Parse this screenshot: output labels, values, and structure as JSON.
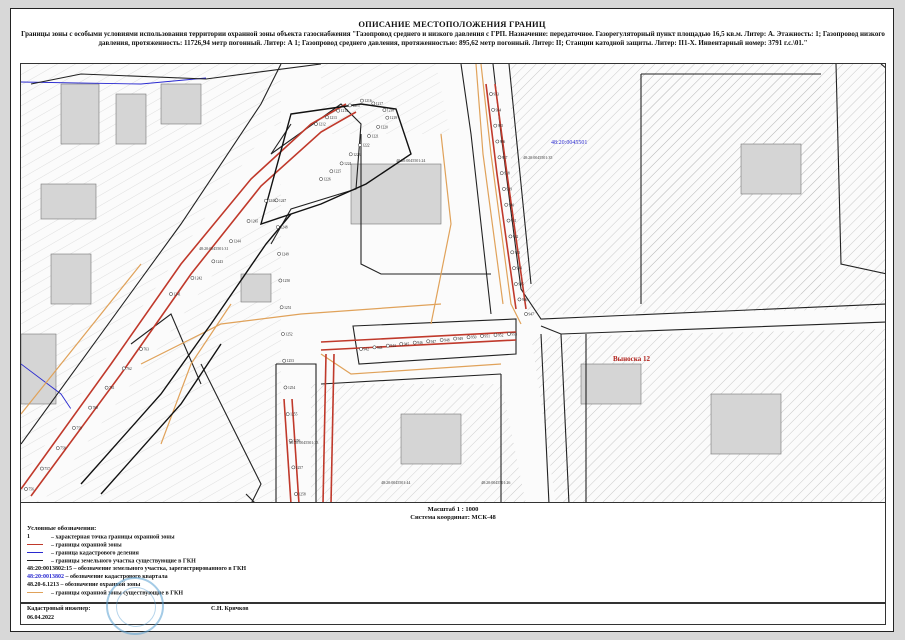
{
  "header": {
    "title": "ОПИСАНИЕ МЕСТОПОЛОЖЕНИЯ ГРАНИЦ",
    "subtitle": "Границы зоны с особыми условиями использования территории охранной зоны объекта газоснабжения \"Газопровод среднего и низкого давления с ГРП. Назначение: передаточное. Газорегуляторный пункт площадью 16,5 кв.м. Литер: А. Этажность: 1; Газопровод низкого давления, протяженность: 11726,94 метр погонный. Литер: А 1; Газопровод среднего давления, протяженностью: 895,62 метр погонный. Литер: II; Станции катодной защиты. Литер: II1-X. Инвентарный номер: 3791 г.с.\\01.\""
  },
  "map": {
    "labels": {
      "quarter_top": "48:20:0045501",
      "extract": "Выноска 12",
      "parcel_1": "48:20:0045501:24",
      "parcel_2": "48:20:0045501:35",
      "parcel_3": "48:20:0045501:31",
      "parcel_4": "48:20:0045501:33",
      "parcel_5": "48:20:0045501:44",
      "parcel_6": "48:20:0045501:26"
    },
    "points_upper": [
      "1212",
      "1213",
      "1214",
      "1215",
      "1216",
      "1217",
      "1218",
      "1219",
      "1220",
      "1221",
      "1222",
      "1223",
      "1224",
      "1225",
      "1226"
    ],
    "points_rail": [
      "933",
      "934",
      "935",
      "936",
      "937",
      "938",
      "939",
      "940",
      "941",
      "942",
      "943",
      "944",
      "945",
      "946",
      "947"
    ],
    "points_block": [
      "942",
      "943",
      "944",
      "945",
      "946",
      "947",
      "948",
      "949",
      "950",
      "951",
      "952",
      "953"
    ],
    "points_lower": [
      "756",
      "757",
      "758",
      "759",
      "760",
      "761",
      "762",
      "763"
    ],
    "points_mid": [
      "1241",
      "1242",
      "1243",
      "1244",
      "1245",
      "1246",
      "1247",
      "1248",
      "1249",
      "1250",
      "1251",
      "1252",
      "1253",
      "1254",
      "1255",
      "1256",
      "1257",
      "1258"
    ],
    "colors": {
      "zone_border": "#c0392b",
      "cadastral_line": "#222222",
      "hatch": "#9a9a9a",
      "building": "#bdbdbd",
      "orange_line": "#e0a25a",
      "blue_label": "#2a2ad0",
      "red_label": "#b2221c"
    }
  },
  "footer": {
    "scale": "Масштаб 1 : 1000",
    "coord_system": "Система координат: МСК-48",
    "legend_title": "Условные обозначения:",
    "legend": [
      {
        "symbol": "1",
        "text": "– характерная точка границы охранной зоны"
      },
      {
        "symbol": "",
        "text": "– границы охранной зоны"
      },
      {
        "symbol": "",
        "text": "– граница кадастрового деления"
      },
      {
        "symbol": "",
        "text": "– границы земельного участка существующие в ГКН"
      },
      {
        "symbol": "48:20:0013802:15",
        "text": "– обозначение земельного участка, зарегистрированного в ГКН"
      },
      {
        "symbol": "48:20:0013802",
        "text": "– обозначение кадастрового квартала"
      },
      {
        "symbol": "48.20-6.1213",
        "text": "– обозначение охранной зоны"
      },
      {
        "symbol": "",
        "text": "– границы охранной зоны существующие в ГКН"
      }
    ],
    "engineer_title": "Кадастровый инженер:",
    "engineer_name": "С.Н. Кричков",
    "date": "06.04.2022"
  }
}
